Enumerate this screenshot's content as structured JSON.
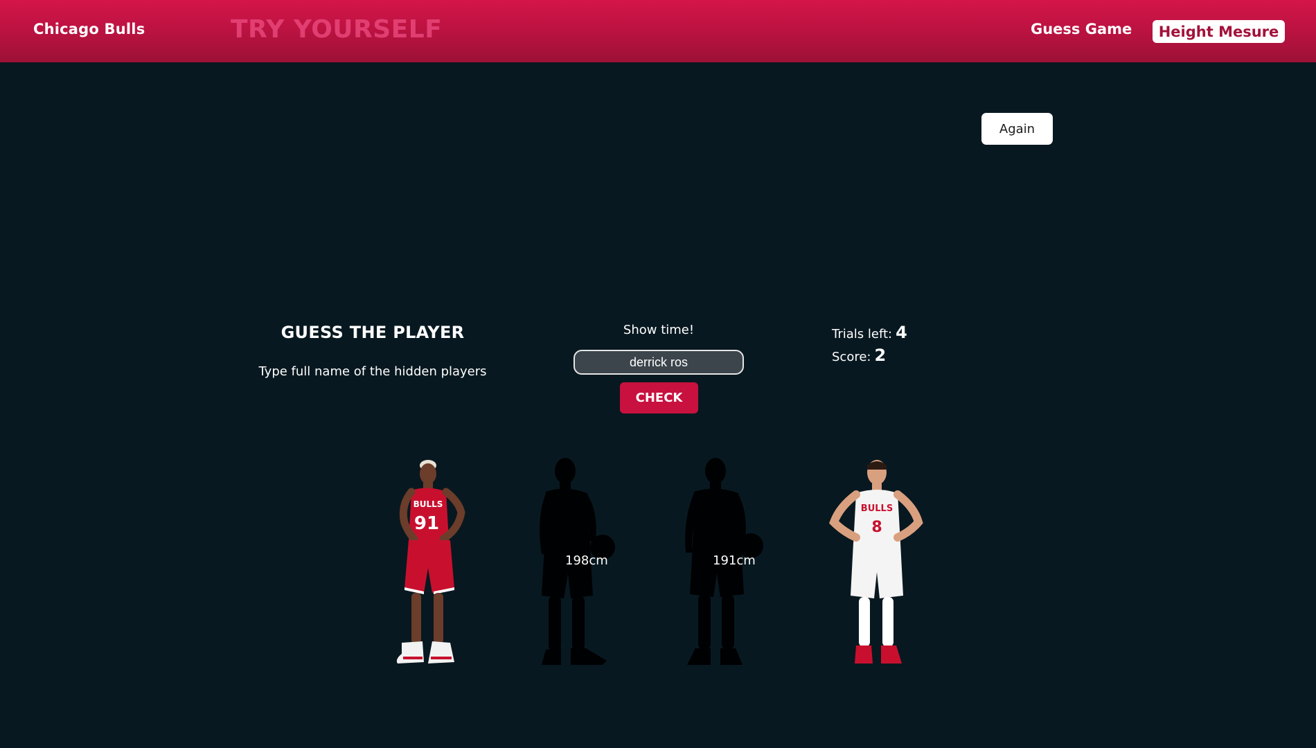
{
  "header": {
    "brand": "Chicago Bulls",
    "hero": "TRY YOURSELF",
    "nav": {
      "guess_game": "Guess Game",
      "height_measure": "Height Mesure"
    }
  },
  "controls": {
    "again_label": "Again"
  },
  "game": {
    "title": "GUESS THE PLAYER",
    "subtitle": "Type full name of the hidden players",
    "prompt": "Show time!",
    "input_value": "derrick ros",
    "check_label": "CHECK",
    "trials_label": "Trials left:",
    "trials_value": "4",
    "score_label": "Score:",
    "score_value": "2"
  },
  "players": [
    {
      "state": "revealed",
      "jersey": "91",
      "jersey_color": "#c8102e"
    },
    {
      "state": "hidden",
      "height": "198cm"
    },
    {
      "state": "hidden",
      "height": "191cm"
    },
    {
      "state": "revealed",
      "jersey": "8",
      "jersey_color": "#f4f4f4"
    }
  ]
}
